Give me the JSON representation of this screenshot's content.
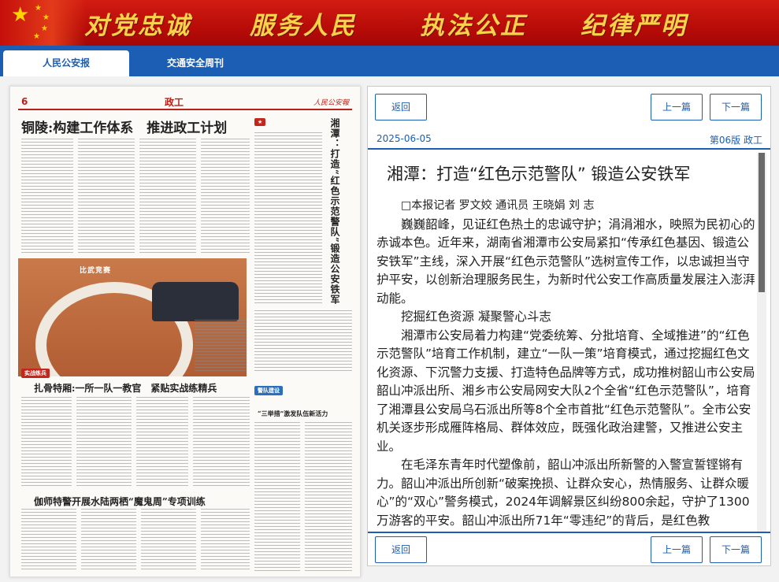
{
  "banner": {
    "slogans": [
      "对党忠诚",
      "服务人民",
      "执法公正",
      "纪律严明"
    ],
    "accent_color": "#c0120c",
    "text_color": "#f7d24a"
  },
  "nav": {
    "tabs": [
      {
        "label": "人民公安报",
        "active": true
      },
      {
        "label": "交通安全周刊",
        "active": false
      }
    ],
    "color": "#1b5eb4"
  },
  "paper_page": {
    "page_number": "6",
    "column": "政工",
    "headline_1": "铜陵:构建工作体系　推进政工计划",
    "headline_2": "扎骨特厢:一所一队一教官　紧贴实战练精兵",
    "headline_3": "伽师特警开展水陆两栖“魔鬼周”专项训练",
    "headline_4": "“三举措”激发队伍新活力",
    "vertical_title": "湘潭：打造“红色示范警队”锻造公安铁军",
    "photo_caption": "比武竞赛",
    "tag_1": "实战练兵",
    "tag_2": "警队建设"
  },
  "article": {
    "buttons": {
      "back": "返回",
      "prev": "上一篇",
      "next": "下一篇"
    },
    "date": "2025-06-05",
    "edition": "第06版 政工",
    "title": "湘潭：打造“红色示范警队” 锻造公安铁军",
    "byline": "□本报记者 罗文姣 通讯员 王晓娟 刘 志",
    "paragraphs": [
      "巍巍韶峰，见证红色热土的忠诚守护；涓涓湘水，映照为民初心的赤诚本色。近年来，湖南省湘潭市公安局紧扣“传承红色基因、锻造公安铁军”主线，深入开展“红色示范警队”选树宣传工作，以忠诚担当守护平安，以创新治理服务民生，为新时代公安工作高质量发展注入澎湃动能。",
      "挖掘红色资源 凝聚警心斗志",
      "湘潭市公安局着力构建“党委统筹、分批培育、全域推进”的“红色示范警队”培育工作机制，建立“一队一策”培育模式，通过挖掘红色文化资源、下沉警力支援、打造特色品牌等方式，成功推树韶山市公安局韶山冲派出所、湘乡市公安局网安大队2个全省“红色示范警队”，培育了湘潭县公安局乌石派出所等8个全市首批“红色示范警队”。全市公安机关逐步形成雁阵格局、群体效应，既强化政治建警，又推进公安主业。",
      "在毛泽东青年时代塑像前，韶山冲派出所新警的入警宣誓铿锵有力。韶山冲派出所创新“破案挽损、让群众安心，热情服务、让群众暖心”的“双心”警务模式，2024年调解景区纠纷800余起，守护了1300万游客的平安。韶山冲派出所71年“零违纪”的背后，是红色教"
    ],
    "link_color": "#1b5eb4"
  }
}
